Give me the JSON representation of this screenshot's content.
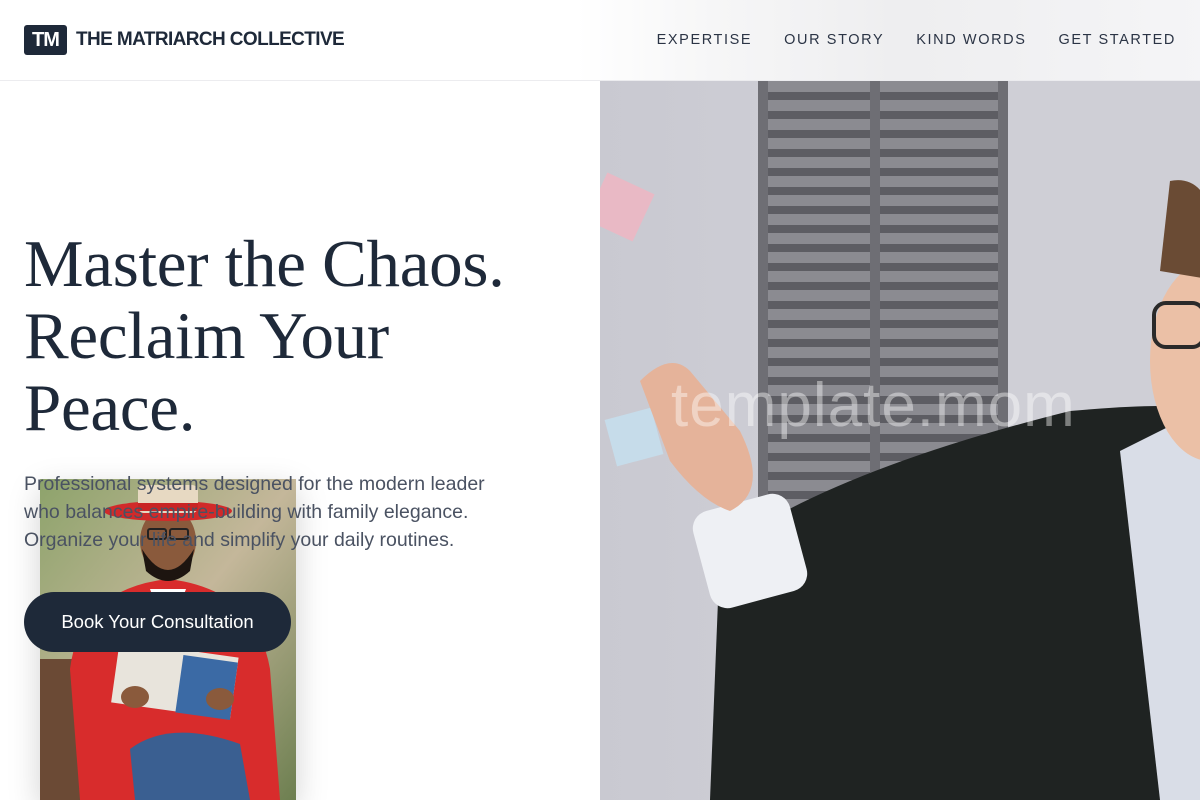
{
  "header": {
    "logo_mark": "TM",
    "brand_name": "THE MATRIARCH COLLECTIVE",
    "nav": [
      {
        "label": "EXPERTISE"
      },
      {
        "label": "OUR STORY"
      },
      {
        "label": "KIND WORDS"
      },
      {
        "label": "GET STARTED"
      }
    ]
  },
  "hero": {
    "title_lines": [
      "Master the Chaos.",
      "Reclaim Your",
      "Peace."
    ],
    "subtitle": "Professional systems designed for the modern leader who balances empire-building with family elegance. Organize your life and simplify your daily routines.",
    "cta_label": "Book Your Consultation",
    "main_image": "woman-at-shuttered-wall-with-sticky-notes",
    "inset_image": "man-in-red-jacket-reading-book"
  },
  "watermark": "template.mom",
  "colors": {
    "primary": "#1e2939",
    "text_secondary": "#4a5262",
    "background": "#ffffff"
  }
}
